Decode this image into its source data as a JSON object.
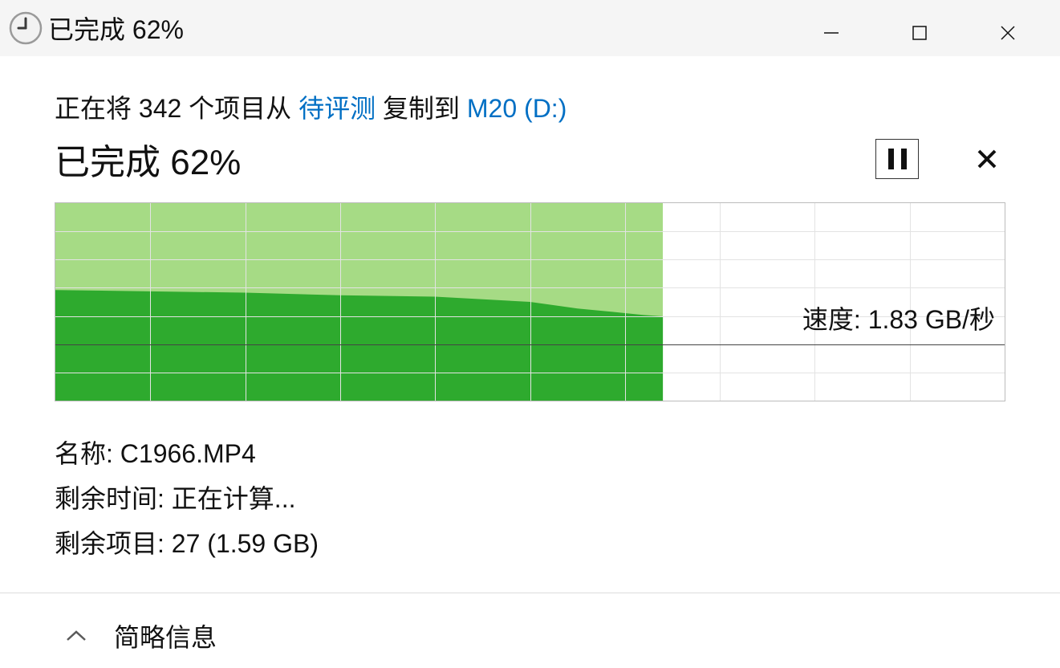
{
  "titlebar": {
    "title": "已完成 62%"
  },
  "copy": {
    "prefix": "正在将 342 个项目从 ",
    "source": "待评测",
    "middle": " 复制到 ",
    "dest": "M20 (D:)"
  },
  "progress": {
    "label": "已完成 62%",
    "percent": 64,
    "speed_text": "速度: 1.83 GB/秒"
  },
  "chart_data": {
    "type": "area",
    "title": "",
    "xlabel": "",
    "ylabel": "速度",
    "ylim": [
      0,
      3.0
    ],
    "grid_columns": 10,
    "grid_rows": 7,
    "axis_row": 5,
    "x": [
      0,
      0.1,
      0.2,
      0.3,
      0.4,
      0.5,
      0.55,
      0.6,
      0.62,
      0.64
    ],
    "values": [
      1.68,
      1.66,
      1.64,
      1.6,
      1.58,
      1.5,
      1.4,
      1.33,
      1.3,
      1.28
    ]
  },
  "details": {
    "name_label": "名称: ",
    "name_value": "C1966.MP4",
    "time_label": "剩余时间: ",
    "time_value": "正在计算...",
    "items_label": "剩余项目: ",
    "items_value": "27 (1.59 GB)"
  },
  "footer": {
    "toggle_label": "简略信息"
  },
  "colors": {
    "link": "#006fc4",
    "fill_light": "#a6db85",
    "fill_dark": "#2eaa2e"
  }
}
